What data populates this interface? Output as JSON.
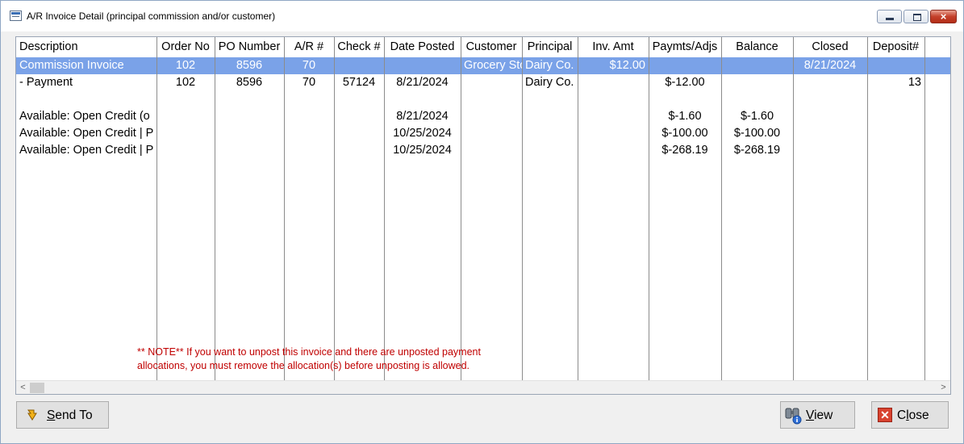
{
  "window": {
    "title": "A/R Invoice Detail (principal commission and/or customer)",
    "icon": "app-window-icon",
    "controls": {
      "minimize": "minimize-icon",
      "maximize": "maximize-icon",
      "close": "×"
    }
  },
  "grid": {
    "columns": [
      {
        "key": "description",
        "label": "Description"
      },
      {
        "key": "order_no",
        "label": "Order No"
      },
      {
        "key": "po_number",
        "label": "PO Number"
      },
      {
        "key": "ar_no",
        "label": "A/R #"
      },
      {
        "key": "check_no",
        "label": "Check #"
      },
      {
        "key": "date_posted",
        "label": "Date Posted"
      },
      {
        "key": "customer",
        "label": "Customer"
      },
      {
        "key": "principal",
        "label": "Principal"
      },
      {
        "key": "inv_amt",
        "label": "Inv. Amt"
      },
      {
        "key": "paymts_adjs",
        "label": "Paymts/Adjs"
      },
      {
        "key": "balance",
        "label": "Balance"
      },
      {
        "key": "closed",
        "label": "Closed"
      },
      {
        "key": "deposit",
        "label": "Deposit#"
      }
    ],
    "rows": [
      {
        "description": "Commission Invoice",
        "order_no": "102",
        "po_number": "8596",
        "ar_no": "70",
        "check_no": "",
        "date_posted": "",
        "customer": "Grocery Store",
        "principal": "Dairy Co.",
        "inv_amt": "$12.00",
        "paymts_adjs": "",
        "balance": "",
        "closed": "8/21/2024",
        "deposit": ""
      },
      {
        "description": " - Payment",
        "order_no": "102",
        "po_number": "8596",
        "ar_no": "70",
        "check_no": "57124",
        "date_posted": "8/21/2024",
        "customer": "",
        "principal": "Dairy Co.",
        "inv_amt": "",
        "paymts_adjs": "$-12.00",
        "balance": "",
        "closed": "",
        "deposit": "13"
      },
      {
        "description": "",
        "order_no": "",
        "po_number": "",
        "ar_no": "",
        "check_no": "",
        "date_posted": "",
        "customer": "",
        "principal": "",
        "inv_amt": "",
        "paymts_adjs": "",
        "balance": "",
        "closed": "",
        "deposit": ""
      },
      {
        "description": "Available: Open Credit (o",
        "order_no": "",
        "po_number": "",
        "ar_no": "",
        "check_no": "",
        "date_posted": "8/21/2024",
        "customer": "",
        "principal": "",
        "inv_amt": "",
        "paymts_adjs": "$-1.60",
        "balance": "$-1.60",
        "closed": "",
        "deposit": ""
      },
      {
        "description": "Available: Open Credit | P",
        "order_no": "",
        "po_number": "",
        "ar_no": "",
        "check_no": "",
        "date_posted": "10/25/2024",
        "customer": "",
        "principal": "",
        "inv_amt": "",
        "paymts_adjs": "$-100.00",
        "balance": "$-100.00",
        "closed": "",
        "deposit": ""
      },
      {
        "description": "Available: Open Credit | P",
        "order_no": "",
        "po_number": "",
        "ar_no": "",
        "check_no": "",
        "date_posted": "10/25/2024",
        "customer": "",
        "principal": "",
        "inv_amt": "",
        "paymts_adjs": "$-268.19",
        "balance": "$-268.19",
        "closed": "",
        "deposit": ""
      }
    ],
    "note_line1": "** NOTE**   If you want to unpost this invoice and there are unposted payment",
    "note_line2": "allocations, you must remove the allocation(s) before unposting is allowed.",
    "scroll_left": "<",
    "scroll_right": ">"
  },
  "buttons": {
    "send_to": {
      "underline": "S",
      "rest": "end To",
      "icon": "send-to-icon"
    },
    "view": {
      "underline": "V",
      "rest": "iew",
      "icon": "binoculars-info-icon"
    },
    "close": {
      "prefix": "C",
      "underline": "l",
      "rest": "ose",
      "icon": "close-x-icon",
      "glyph": "✕"
    }
  },
  "colors": {
    "selected_row": "#7aa2e8",
    "note_text": "#c00000",
    "close_button": "#d8422f"
  }
}
